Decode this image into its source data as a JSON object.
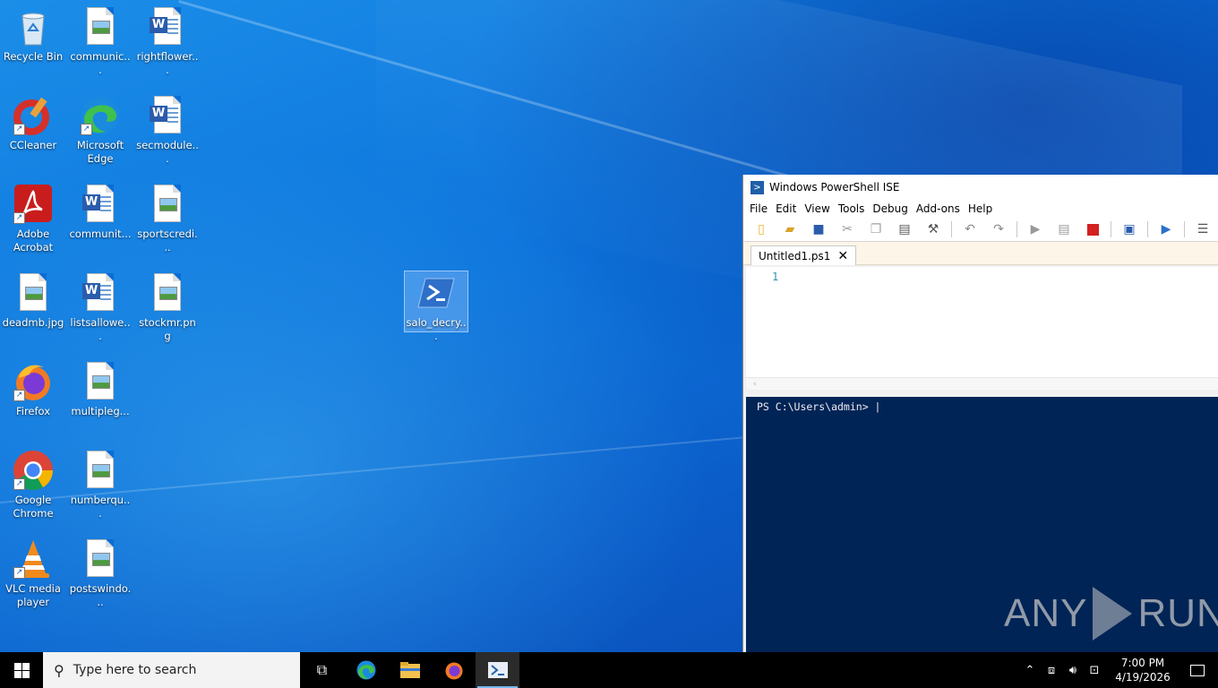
{
  "desktop": {
    "icons": [
      {
        "label": "Recycle Bin"
      },
      {
        "label": "communic..."
      },
      {
        "label": "rightflower..."
      },
      {
        "label": "CCleaner"
      },
      {
        "label": "Microsoft Edge"
      },
      {
        "label": "secmodule..."
      },
      {
        "label": "Adobe Acrobat"
      },
      {
        "label": "communit..."
      },
      {
        "label": "sportscredi..."
      },
      {
        "label": "deadmb.jpg"
      },
      {
        "label": "listsallowe..."
      },
      {
        "label": "stockmr.png"
      },
      {
        "label": "salo_decry..."
      },
      {
        "label": "Firefox"
      },
      {
        "label": "multipleg..."
      },
      {
        "label": "Google Chrome"
      },
      {
        "label": "numberqu..."
      },
      {
        "label": "VLC media player"
      },
      {
        "label": "postswindo..."
      }
    ]
  },
  "ise": {
    "title": "Windows PowerShell ISE",
    "menu": [
      "File",
      "Edit",
      "View",
      "Tools",
      "Debug",
      "Add-ons",
      "Help"
    ],
    "tab_label": "Untitled1.ps1",
    "line_number": "1",
    "console_prompt": "PS C:\\Users\\admin> |",
    "watermark": {
      "left": "ANY",
      "right": "RUN"
    }
  },
  "taskbar": {
    "search_placeholder": "Type here to search",
    "time": "7:00 PM",
    "date": "4/19/2026"
  }
}
